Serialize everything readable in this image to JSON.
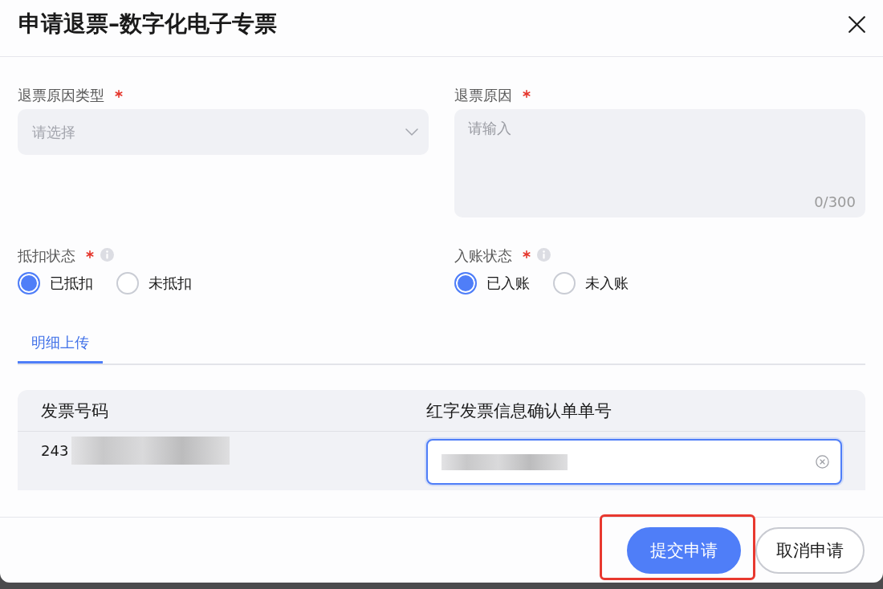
{
  "dialog": {
    "title": "申请退票–数字化电子专票"
  },
  "fields": [
    {
      "kind": "select",
      "label": "退票原因类型",
      "required": true,
      "placeholder": "请选择"
    },
    {
      "kind": "textarea",
      "label": "退票原因",
      "required": true,
      "placeholder": "请输入",
      "counter": "0/300"
    }
  ],
  "radio_groups": [
    {
      "label": "抵扣状态",
      "required": true,
      "info": true,
      "options": [
        {
          "label": "已抵扣",
          "selected": true
        },
        {
          "label": "未抵扣",
          "selected": false
        }
      ]
    },
    {
      "label": "入账状态",
      "required": true,
      "info": true,
      "options": [
        {
          "label": "已入账",
          "selected": true
        },
        {
          "label": "未入账",
          "selected": false
        }
      ]
    }
  ],
  "tabs": [
    {
      "label": "明细上传",
      "selected": true
    }
  ],
  "table": {
    "columns": [
      "发票号码",
      "红字发票信息确认单单号"
    ],
    "rows": [
      {
        "invoice_number": "243",
        "invoice_number_redacted": true,
        "confirmation_number": {
          "focused": true,
          "redacted": true
        }
      }
    ]
  },
  "footer": {
    "buttons": [
      {
        "label": "提交申请",
        "kind": "primary",
        "highlighted": true
      },
      {
        "label": "取消申请",
        "kind": "secondary",
        "highlighted": false
      }
    ]
  }
}
